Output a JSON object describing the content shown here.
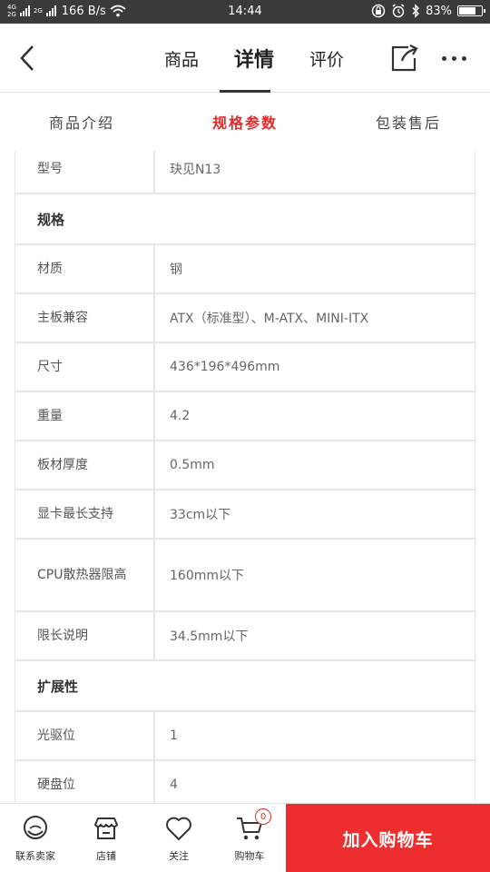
{
  "status_bar": {
    "network_top": "4G",
    "network_bottom": "2G",
    "network2": "2G",
    "speed": "166 B/s",
    "time": "14:44",
    "battery": "83%",
    "battery_level": 0.83
  },
  "header": {
    "tabs": [
      {
        "label": "商品"
      },
      {
        "label": "详情"
      },
      {
        "label": "评价"
      }
    ],
    "active_tab": 1
  },
  "sub_tabs": [
    {
      "label": "商品介绍"
    },
    {
      "label": "规格参数"
    },
    {
      "label": "包装售后"
    }
  ],
  "specs": {
    "model": {
      "key": "型号",
      "value": "玦见N13"
    },
    "section_spec": "规格",
    "material": {
      "key": "材质",
      "value": "钢"
    },
    "mobo": {
      "key": "主板兼容",
      "value": "ATX（标准型）、M-ATX、MINI-ITX"
    },
    "size": {
      "key": "尺寸",
      "value": "436*196*496mm"
    },
    "weight": {
      "key": "重量",
      "value": "4.2"
    },
    "thickness": {
      "key": "板材厚度",
      "value": "0.5mm"
    },
    "gpu": {
      "key": "显卡最长支持",
      "value": "33cm以下"
    },
    "cpu": {
      "key": "CPU散热器限高",
      "value": "160mm以下"
    },
    "limit": {
      "key": "限长说明",
      "value": "34.5mm以下"
    },
    "section_ext": "扩展性",
    "optical": {
      "key": "光驱位",
      "value": "1"
    },
    "hdd": {
      "key": "硬盘位",
      "value": "4"
    }
  },
  "bottom_bar": {
    "contact": "联系卖家",
    "shop": "店铺",
    "follow": "关注",
    "cart": "购物车",
    "cart_badge": "0",
    "add_cart": "加入购物车"
  },
  "colors": {
    "accent": "#ee2e2e",
    "status_bar_bg": "#3a3a3a"
  }
}
